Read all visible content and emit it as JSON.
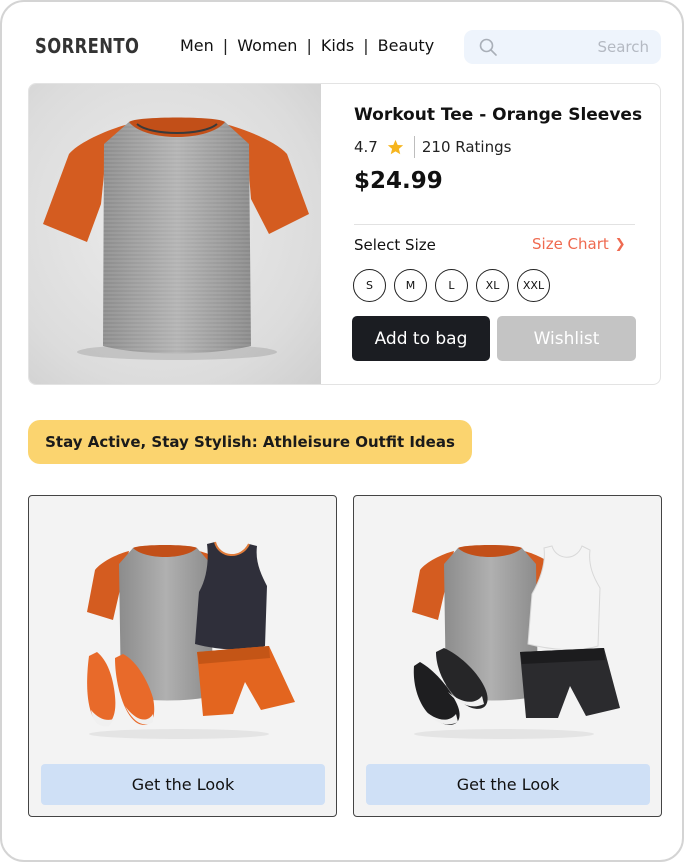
{
  "brand": {
    "logo": "SORRENTO"
  },
  "nav": {
    "items": [
      "Men",
      "Women",
      "Kids",
      "Beauty"
    ],
    "separator": "|"
  },
  "search": {
    "placeholder": "Search",
    "icon": "search-icon"
  },
  "product": {
    "title": "Workout Tee - Orange Sleeves",
    "rating": "4.7",
    "rating_icon": "star-icon",
    "ratings_count": "210 Ratings",
    "price": "$24.99",
    "select_size_label": "Select Size",
    "size_chart_label": "Size Chart",
    "size_chart_icon": "chevron-right-icon",
    "sizes": [
      "S",
      "M",
      "L",
      "XL",
      "XXL"
    ],
    "add_to_bag_label": "Add to bag",
    "wishlist_label": "Wishlist"
  },
  "banner": {
    "text": "Stay Active, Stay Stylish: Athleisure Outfit Ideas"
  },
  "looks": [
    {
      "button_label": "Get the Look"
    },
    {
      "button_label": "Get the Look"
    }
  ],
  "colors": {
    "accent_orange": "#e0672a",
    "size_chart": "#ef6a50",
    "banner": "#fbd46f",
    "primary_button": "#1b1d22",
    "secondary_button": "#c4c4c4",
    "look_button": "#cfe0f6",
    "search_bg": "#eef4fc"
  }
}
